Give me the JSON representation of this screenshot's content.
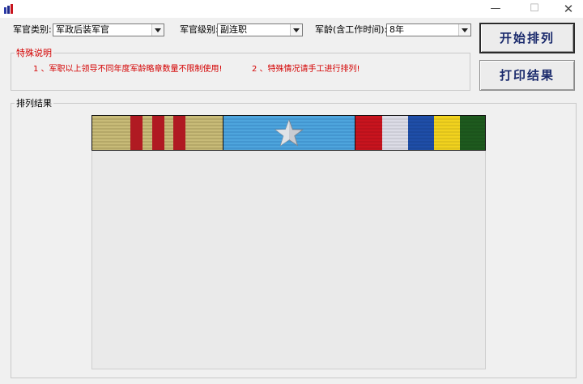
{
  "window": {
    "title": "",
    "controls": {
      "minimize": "—",
      "maximize": "☐",
      "close": "✕"
    }
  },
  "form": {
    "category": {
      "label": "军官类别:",
      "value": "军政后装军官"
    },
    "rank": {
      "label": "军官级别:",
      "value": "副连职"
    },
    "service_years": {
      "label": "军龄(含工作时间):",
      "value": "8年"
    }
  },
  "buttons": {
    "start": "开始排列",
    "print": "打印结果"
  },
  "notes": {
    "title": "特殊说明",
    "items": [
      "1 、军职以上领导不同年度军龄略章数量不限制使用!",
      "2 、特殊情况请手工进行排列!"
    ]
  },
  "results": {
    "title": "排列结果",
    "ribbons": [
      {
        "name": "khaki-red-stripe-ribbon",
        "base": "#c8bb78",
        "stripes": [
          "#b01a22",
          "#b01a22",
          "#b01a22"
        ]
      },
      {
        "name": "blue-star-ribbon",
        "base": "#4ea5dd",
        "device": "silver-star-icon"
      },
      {
        "name": "multicolor-ribbon",
        "colors": [
          "#c8141e",
          "#dcdce6",
          "#1f4ea8",
          "#f1d21e",
          "#1e5a1e"
        ]
      }
    ]
  },
  "colors": {
    "note_text": "#d40000",
    "button_text": "#1a2a6c",
    "background": "#f0f0f0"
  }
}
